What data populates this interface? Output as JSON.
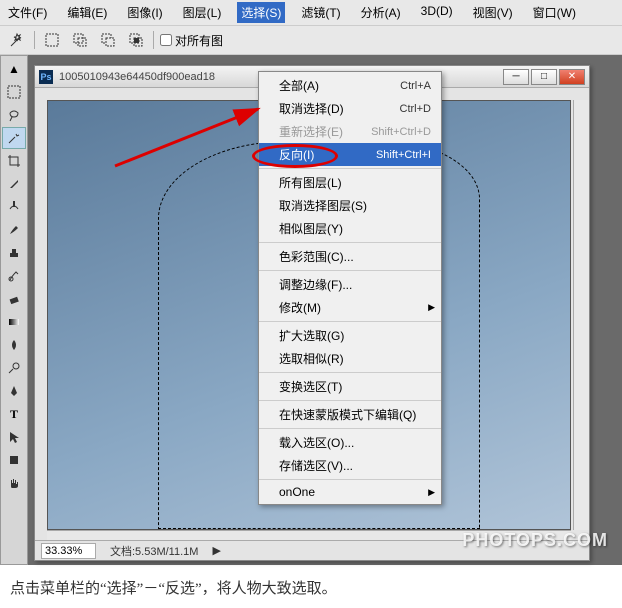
{
  "menubar": {
    "items": [
      {
        "label": "文件(F)"
      },
      {
        "label": "编辑(E)"
      },
      {
        "label": "图像(I)"
      },
      {
        "label": "图层(L)"
      },
      {
        "label": "选择(S)",
        "active": true
      },
      {
        "label": "滤镜(T)"
      },
      {
        "label": "分析(A)"
      },
      {
        "label": "3D(D)"
      },
      {
        "label": "视图(V)"
      },
      {
        "label": "窗口(W)"
      }
    ]
  },
  "options_bar": {
    "checkbox_label": "对所有图"
  },
  "document": {
    "title": "1005010943e64450df900ead18",
    "zoom": "33.33%",
    "doc_size_label": "文档:5.53M/11.1M"
  },
  "select_menu": {
    "groups": [
      [
        {
          "label": "全部(A)",
          "shortcut": "Ctrl+A"
        },
        {
          "label": "取消选择(D)",
          "shortcut": "Ctrl+D"
        },
        {
          "label": "重新选择(E)",
          "shortcut": "Shift+Ctrl+D",
          "disabled": true
        },
        {
          "label": "反向(I)",
          "shortcut": "Shift+Ctrl+I",
          "highlight": true
        }
      ],
      [
        {
          "label": "所有图层(L)"
        },
        {
          "label": "取消选择图层(S)"
        },
        {
          "label": "相似图层(Y)"
        }
      ],
      [
        {
          "label": "色彩范围(C)..."
        }
      ],
      [
        {
          "label": "调整边缘(F)..."
        },
        {
          "label": "修改(M)",
          "submenu": true
        }
      ],
      [
        {
          "label": "扩大选取(G)"
        },
        {
          "label": "选取相似(R)"
        }
      ],
      [
        {
          "label": "变换选区(T)"
        }
      ],
      [
        {
          "label": "在快速蒙版模式下编辑(Q)"
        }
      ],
      [
        {
          "label": "载入选区(O)..."
        },
        {
          "label": "存储选区(V)..."
        }
      ],
      [
        {
          "label": "onOne",
          "submenu": true
        }
      ]
    ]
  },
  "caption_text": "点击菜单栏的“选择”－“反选”，将人物大致选取。",
  "watermark": "PHOTOPS.COM"
}
